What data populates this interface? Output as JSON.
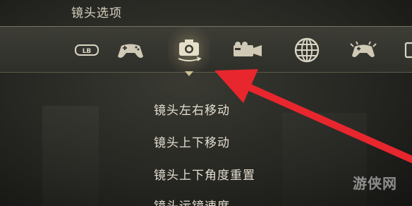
{
  "header": {
    "title": "镜头选项"
  },
  "tabs": [
    {
      "icon": "lb-bumper-icon",
      "label": "LB"
    },
    {
      "icon": "controller-icon"
    },
    {
      "icon": "camera-icon",
      "active": true
    },
    {
      "icon": "film-camera-icon"
    },
    {
      "icon": "globe-icon"
    },
    {
      "icon": "controller-vibration-icon"
    },
    {
      "icon": "more-icon"
    }
  ],
  "menu": {
    "items": [
      {
        "label": "镜头左右移动"
      },
      {
        "label": "镜头上下移动"
      },
      {
        "label": "镜头上下角度重置"
      },
      {
        "label": "镜头运镜速度"
      }
    ]
  },
  "annotation": {
    "color": "#e8262d"
  },
  "watermark": {
    "text": "游侠网"
  }
}
